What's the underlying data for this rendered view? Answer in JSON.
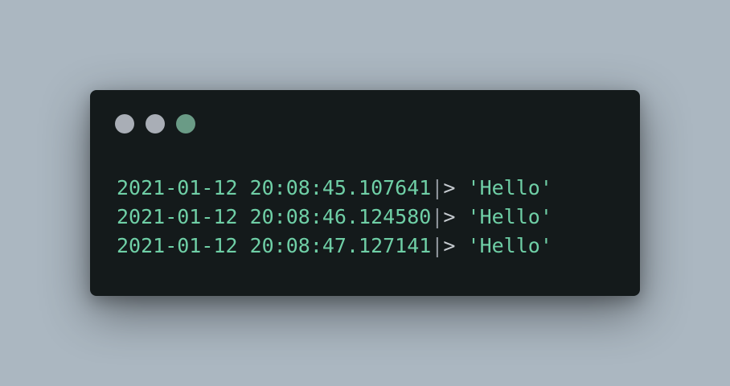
{
  "colors": {
    "background": "#abb7c1",
    "window": "#141a1b",
    "close_dot": "#a9aeb6",
    "minimize_dot": "#a9aeb6",
    "maximize_dot": "#6a9b86",
    "timestamp": "#6fcfa6",
    "string": "#6fcfa6"
  },
  "terminal": {
    "lines": [
      {
        "timestamp": "2021-01-12 20:08:45.107641",
        "separator": "|",
        "prompt": ">",
        "value": "'Hello'"
      },
      {
        "timestamp": "2021-01-12 20:08:46.124580",
        "separator": "|",
        "prompt": ">",
        "value": "'Hello'"
      },
      {
        "timestamp": "2021-01-12 20:08:47.127141",
        "separator": "|",
        "prompt": ">",
        "value": "'Hello'"
      }
    ]
  }
}
